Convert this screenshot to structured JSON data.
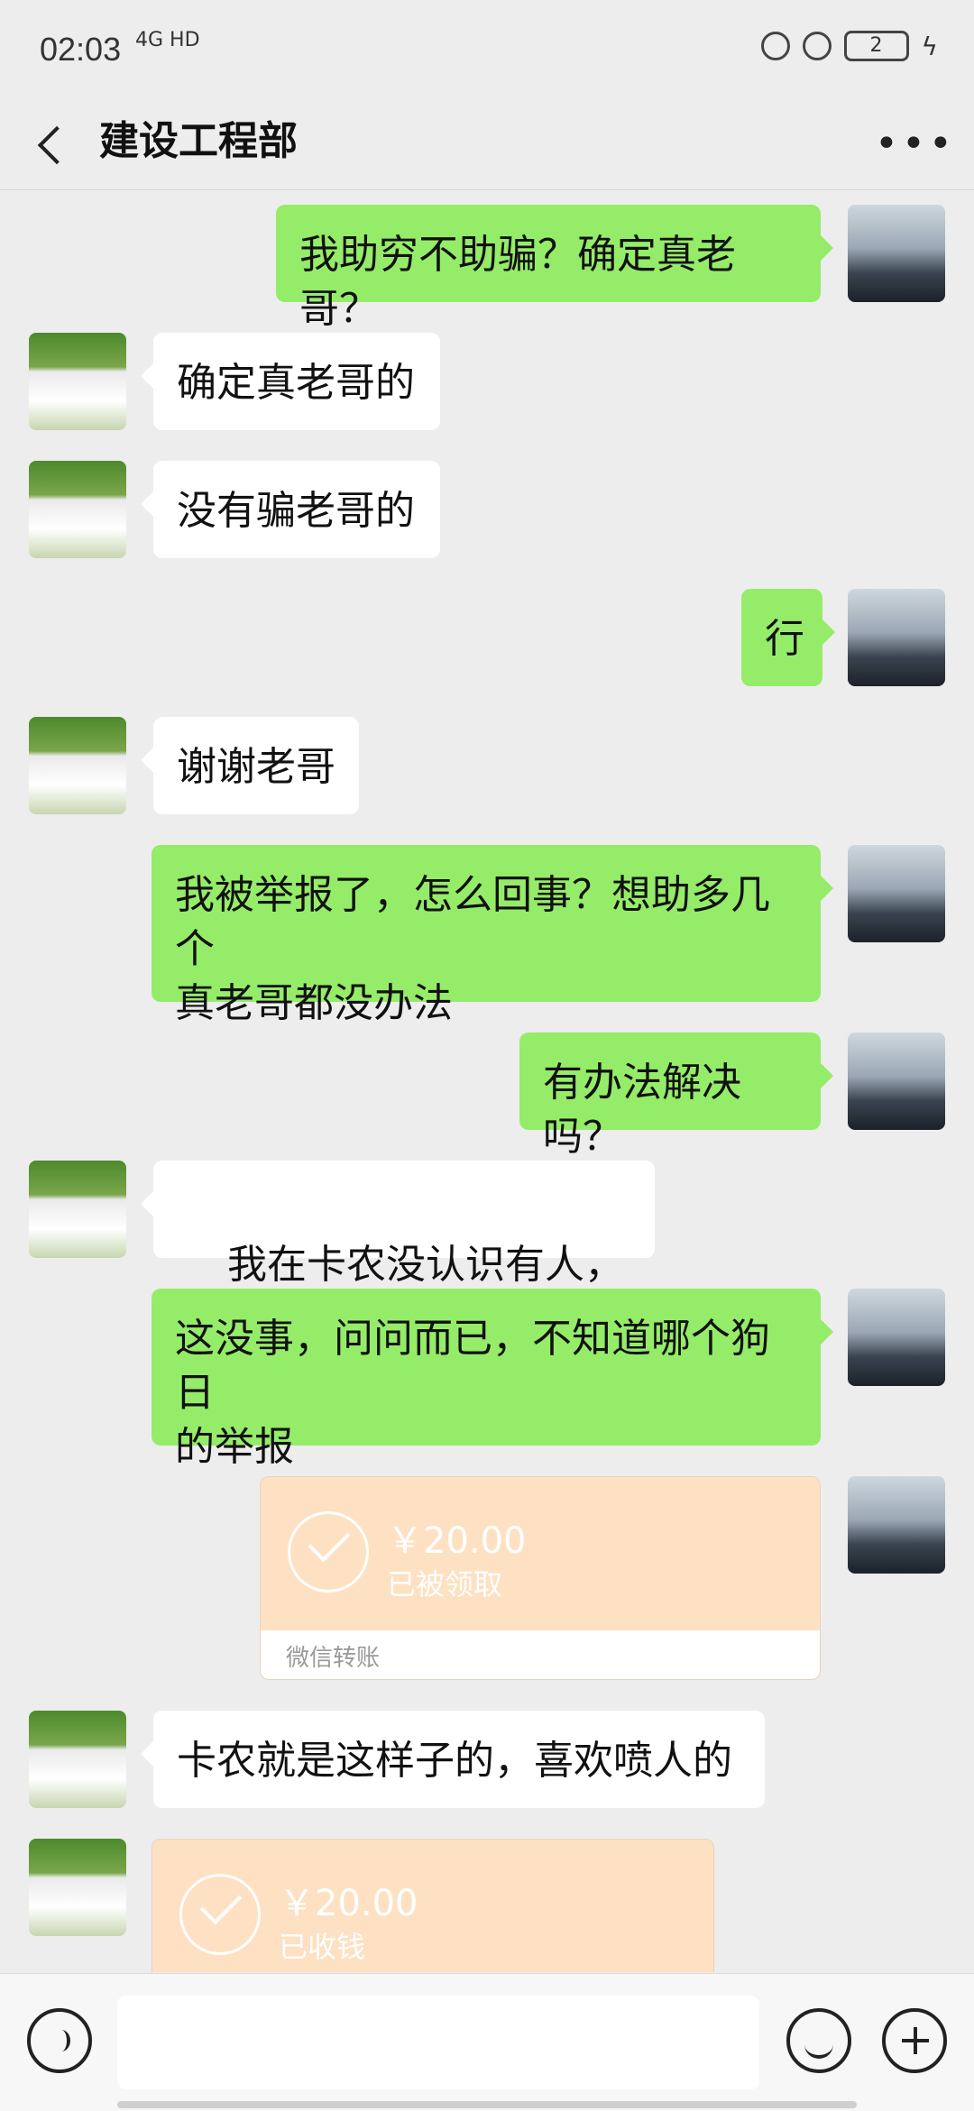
{
  "status_bar": {
    "time": "02:03",
    "network": "4G HD",
    "battery": "2"
  },
  "header": {
    "title": "建设工程部"
  },
  "messages": [
    {
      "side": "out",
      "text": "我助穷不助骗？确定真老哥？"
    },
    {
      "side": "in",
      "text": "确定真老哥的"
    },
    {
      "side": "in",
      "text": "没有骗老哥的"
    },
    {
      "side": "out",
      "text": "行"
    },
    {
      "side": "in",
      "text": "谢谢老哥"
    },
    {
      "side": "out",
      "text": "我被举报了，怎么回事？想助多几个\n真老哥都没办法"
    },
    {
      "side": "out",
      "text": "有办法解决吗？"
    },
    {
      "side": "in",
      "text": "我在卡农没认识有人，"
    },
    {
      "side": "out",
      "text": "这没事，问问而已，不知道哪个狗日\n的举报"
    },
    {
      "side": "out",
      "type": "transfer",
      "amount": "￥20.00",
      "status": "已被领取",
      "label": "微信转账"
    },
    {
      "side": "in",
      "text": "卡农就是这样子的，喜欢喷人的"
    },
    {
      "side": "in",
      "type": "transfer",
      "amount": "￥20.00",
      "status": "已收钱"
    }
  ],
  "colors": {
    "outgoing": "#95ec69",
    "incoming": "#ffffff",
    "transfer": "#fde1c2",
    "background": "#ededed"
  }
}
